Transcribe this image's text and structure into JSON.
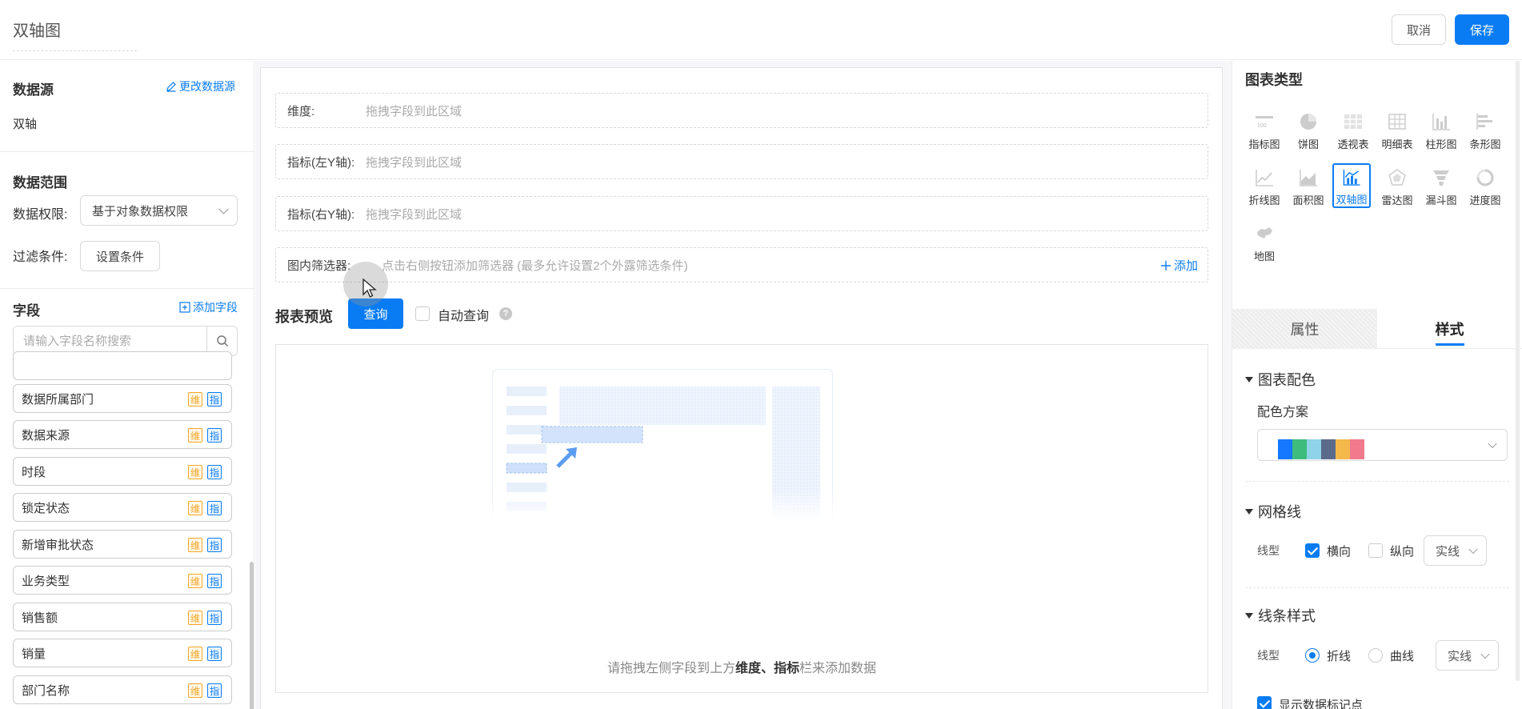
{
  "header": {
    "title": "双轴图",
    "cancel": "取消",
    "save": "保存"
  },
  "left": {
    "datasource": {
      "title": "数据源",
      "change_link": "更改数据源",
      "value": "双轴"
    },
    "range": {
      "title": "数据范围",
      "permission_label": "数据权限:",
      "permission_value": "基于对象数据权限",
      "filter_label": "过滤条件:",
      "filter_button": "设置条件"
    },
    "fields": {
      "title": "字段",
      "add_link": "添加字段",
      "search_placeholder": "请输入字段名称搜索",
      "tag_dim": "维",
      "tag_metric": "指",
      "items": [
        "数据所属部门",
        "数据来源",
        "时段",
        "锁定状态",
        "新增审批状态",
        "业务类型",
        "销售额",
        "销量",
        "部门名称"
      ]
    }
  },
  "center": {
    "dimension_label": "维度:",
    "left_metric_label": "指标(左Y轴):",
    "right_metric_label": "指标(右Y轴):",
    "drop_hint": "拖拽字段到此区域",
    "filter_label": "图内筛选器:",
    "filter_hint": "点击右侧按钮添加筛选器 (最多允许设置2个外露筛选条件)",
    "add_filter": "添加",
    "preview_title": "报表预览",
    "query_button": "查询",
    "auto_query": "自动查询",
    "empty_prefix": "请拖拽左侧字段到上方",
    "empty_bold": "维度、指标",
    "empty_suffix": "栏来添加数据"
  },
  "right": {
    "chart_type_title": "图表类型",
    "chart_types": [
      "指标图",
      "饼图",
      "透视表",
      "明细表",
      "柱形图",
      "条形图",
      "折线图",
      "面积图",
      "双轴图",
      "雷达图",
      "漏斗图",
      "进度图",
      "地图"
    ],
    "selected_chart_type": "双轴图",
    "tabs": {
      "props": "属性",
      "style": "样式"
    },
    "color_section": "图表配色",
    "color_scheme_label": "配色方案",
    "palette": [
      "#1677ff",
      "#3dbd7d",
      "#8fd3e8",
      "#5b6b8c",
      "#f5b84b",
      "#f07a8c"
    ],
    "grid_section": "网格线",
    "line_type_label": "线型",
    "grid_horizontal": "横向",
    "grid_vertical": "纵向",
    "grid_style": "实线",
    "line_section": "线条样式",
    "line_fold": "折线",
    "line_curve": "曲线",
    "line_style": "实线",
    "show_markers": "显示数据标记点"
  }
}
